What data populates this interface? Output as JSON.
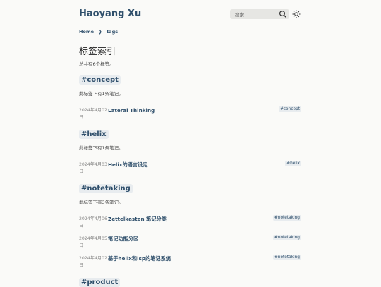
{
  "header": {
    "site_title": "Haoyang Xu",
    "search_placeholder": "搜索"
  },
  "icons": {
    "search": "search-icon",
    "theme": "sun-icon"
  },
  "breadcrumb": {
    "home": "Home",
    "separator": "❯",
    "current": "tags"
  },
  "page": {
    "title": "标签索引",
    "summary": "总共有6个标签。"
  },
  "sections": [
    {
      "tag": "#concept",
      "desc": "此标签下有1条笔记。",
      "notes": [
        {
          "date": "2024年4月02日",
          "title": "Lateral Thinking",
          "tag": "#concept"
        }
      ]
    },
    {
      "tag": "#helix",
      "desc": "此标签下有1条笔记。",
      "notes": [
        {
          "date": "2024年4月03日",
          "title": "Helix的语言设定",
          "tag": "#helix"
        }
      ]
    },
    {
      "tag": "#notetaking",
      "desc": "此标签下有3条笔记。",
      "notes": [
        {
          "date": "2024年4月06日",
          "title": "Zettelkasten 笔记分类",
          "tag": "#notetaking"
        },
        {
          "date": "2024年4月05日",
          "title": "笔记功能分区",
          "tag": "#notetaking"
        },
        {
          "date": "2024年4月02日",
          "title": "基于helix和lsp的笔记系统",
          "tag": "#notetaking"
        }
      ]
    },
    {
      "tag": "#product",
      "desc": "",
      "notes": []
    }
  ]
}
